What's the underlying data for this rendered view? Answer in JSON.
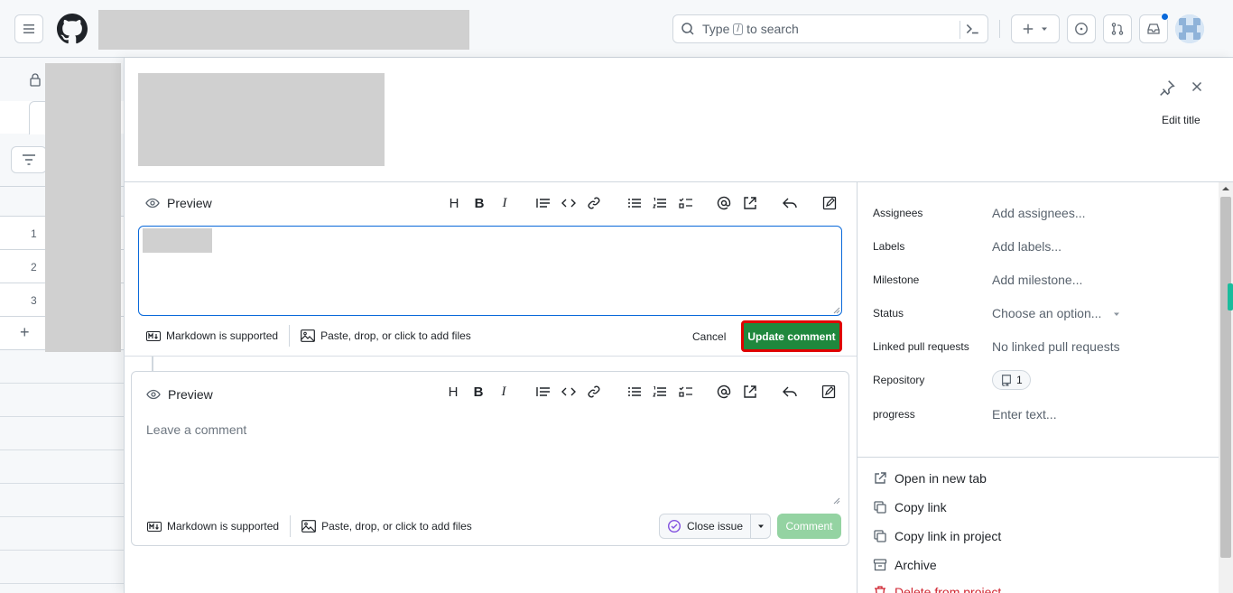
{
  "header": {
    "search_placeholder_pre": "Type",
    "search_key": "/",
    "search_placeholder_post": "to search"
  },
  "background_table": {
    "rows": [
      "1",
      "2",
      "3"
    ],
    "add_label": "+"
  },
  "panel": {
    "edit_title": "Edit title",
    "edit_editor": {
      "preview_label": "Preview",
      "markdown_label": "Markdown is supported",
      "files_label": "Paste, drop, or click to add files",
      "cancel_label": "Cancel",
      "update_label": "Update comment"
    },
    "new_editor": {
      "preview_label": "Preview",
      "placeholder": "Leave a comment",
      "markdown_label": "Markdown is supported",
      "files_label": "Paste, drop, or click to add files",
      "close_issue_label": "Close issue",
      "comment_label": "Comment"
    },
    "toolbar_glyphs": {
      "heading": "H",
      "bold": "B",
      "italic": "I"
    }
  },
  "sidebar": {
    "fields": [
      {
        "label": "Assignees",
        "value": "Add assignees..."
      },
      {
        "label": "Labels",
        "value": "Add labels..."
      },
      {
        "label": "Milestone",
        "value": "Add milestone..."
      },
      {
        "label": "Status",
        "value": "Choose an option..."
      },
      {
        "label": "Linked pull requests",
        "value": "No linked pull requests"
      },
      {
        "label": "Repository",
        "value": "1"
      },
      {
        "label": "progress",
        "value": "Enter text..."
      }
    ],
    "actions": [
      {
        "label": "Open in new tab",
        "icon": "external-link-icon"
      },
      {
        "label": "Copy link",
        "icon": "copy-icon"
      },
      {
        "label": "Copy link in project",
        "icon": "copy-icon"
      },
      {
        "label": "Archive",
        "icon": "archive-icon"
      },
      {
        "label": "Delete from project",
        "icon": "trash-icon"
      }
    ]
  },
  "colors": {
    "primary_button": "#1f883d",
    "highlight_border": "#e00000",
    "link_blue": "#0969da",
    "danger": "#cf222e"
  }
}
